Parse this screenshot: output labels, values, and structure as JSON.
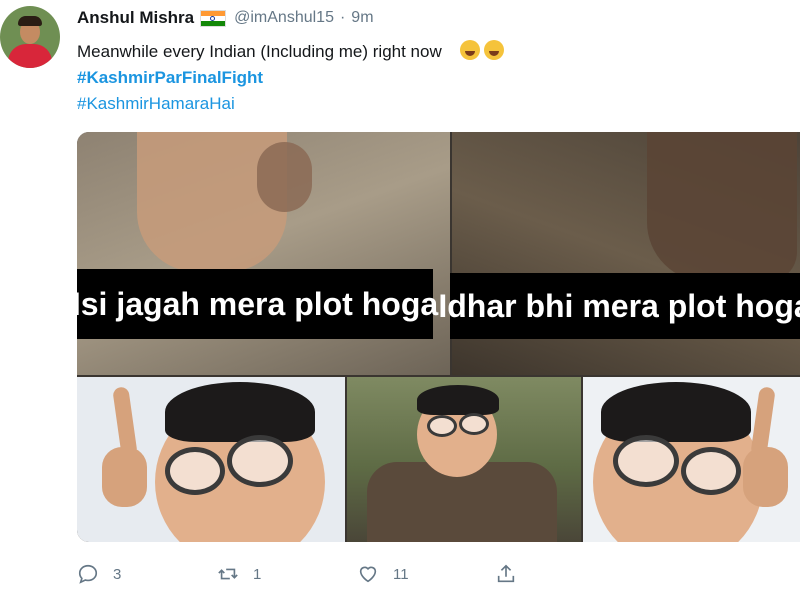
{
  "author": {
    "name": "Anshul Mishra",
    "handle": "@imAnshul15",
    "separator": "·",
    "time": "9m"
  },
  "tweet": {
    "text": "Meanwhile every Indian (Including me) right now",
    "hashtags": [
      "#KashmirParFinalFight",
      "#KashmirHamaraHai"
    ]
  },
  "media": {
    "captions": [
      "Isi jagah mera plot hoga",
      "Idhar bhi mera plot hoga"
    ]
  },
  "actions": {
    "replies": "3",
    "retweets": "1",
    "likes": "11"
  },
  "icons": {
    "reply": "reply-icon",
    "retweet": "retweet-icon",
    "like": "heart-icon",
    "share": "share-icon"
  },
  "colors": {
    "hashtag": "#1b95e0",
    "secondary_text": "#657786"
  }
}
